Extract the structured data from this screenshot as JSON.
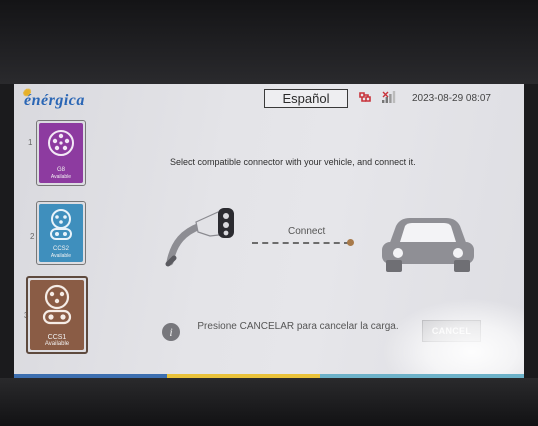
{
  "header": {
    "brand": "énérgica",
    "language_label": "Español",
    "datetime": "2023-08-29 08:07"
  },
  "connectors": [
    {
      "index": "1",
      "name": "G8",
      "status": "Available",
      "color": "#8d3ba0"
    },
    {
      "index": "2",
      "name": "CCS2",
      "status": "Available",
      "color": "#3f8fbd"
    },
    {
      "index": "3",
      "name": "CCS1",
      "status": "Available",
      "color": "#8a5c45"
    }
  ],
  "main": {
    "instruction": "Select compatible connector with your vehicle, and connect it.",
    "connect_label": "Connect",
    "info_text": "Presione CANCELAR para cancelar la carga.",
    "cancel_label": "CANCEL"
  },
  "icons": {
    "status_a": "network-error-icon",
    "status_b": "signal-strength-icon"
  },
  "colors": {
    "brand_blue": "#2a66b5",
    "brand_yellow": "#e6b12a"
  }
}
